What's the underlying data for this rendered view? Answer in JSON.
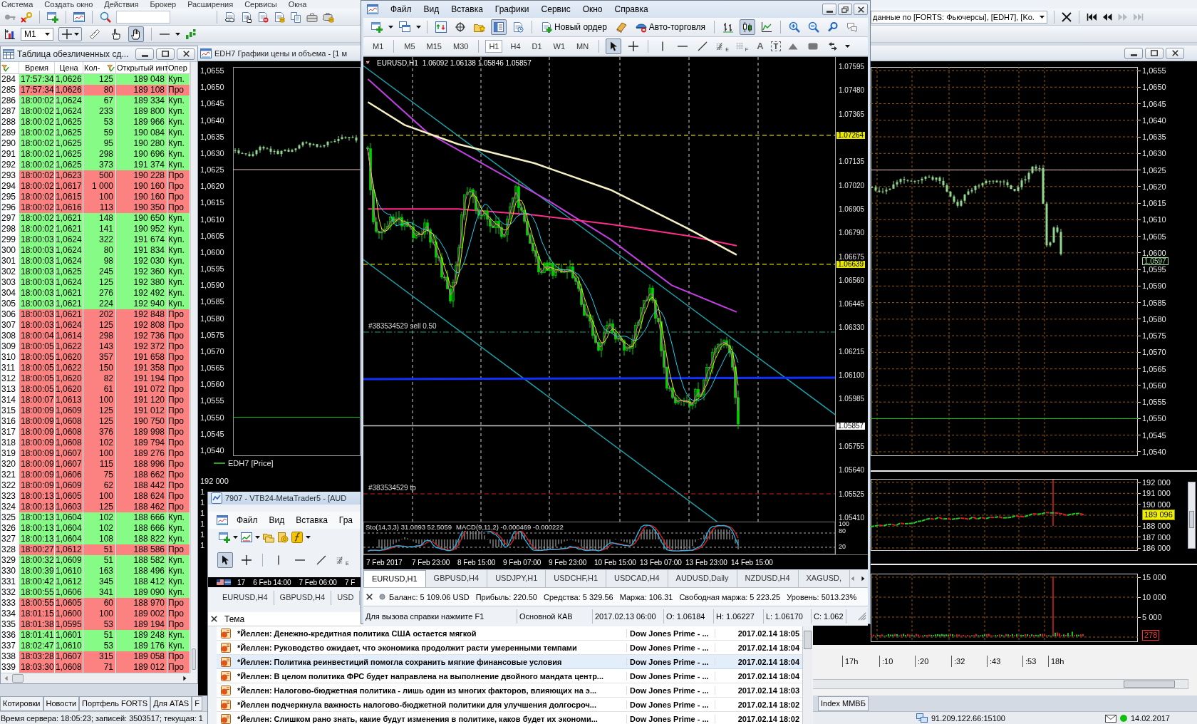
{
  "app_menu": [
    "Система",
    "Создать окно",
    "Действия",
    "Брокер",
    "Расширения",
    "Сервисы",
    "Окна"
  ],
  "app_toolbar": {
    "timeframe": "M1",
    "tools": [
      {
        "kind": "ruler",
        "selected": false
      },
      {
        "kind": "hand-point",
        "selected": false
      },
      {
        "kind": "hand",
        "selected": true
      }
    ],
    "data_source": "данные по [FORTS: Фьючерсы], [EDH7], [Ko.",
    "nav_buttons": [
      {
        "kind": "first",
        "disabled": false
      },
      {
        "kind": "back",
        "disabled": false
      },
      {
        "kind": "forward",
        "disabled": true
      },
      {
        "kind": "last",
        "disabled": true
      }
    ]
  },
  "trades": {
    "title": "Таблица обезличенных сд...",
    "columns": [
      "Время",
      "Цена",
      "Кол-",
      "Открытый инт",
      "Опер"
    ],
    "rows": [
      {
        "n": "284",
        "time": "17:57:34",
        "price": "1,0626",
        "qty": "125",
        "oi": "189 048",
        "op": "Куп.",
        "kind": "buy"
      },
      {
        "n": "285",
        "time": "17:57:34",
        "price": "1,0626",
        "qty": "80",
        "oi": "189 108",
        "op": "Про",
        "kind": "sell"
      },
      {
        "n": "286",
        "time": "18:00:02",
        "price": "1,0624",
        "qty": "67",
        "oi": "189 334",
        "op": "Куп.",
        "kind": "buy"
      },
      {
        "n": "287",
        "time": "18:00:02",
        "price": "1,0624",
        "qty": "233",
        "oi": "189 800",
        "op": "Куп.",
        "kind": "buy"
      },
      {
        "n": "288",
        "time": "18:00:02",
        "price": "1,0625",
        "qty": "53",
        "oi": "189 966",
        "op": "Куп.",
        "kind": "buy"
      },
      {
        "n": "289",
        "time": "18:00:02",
        "price": "1,0625",
        "qty": "59",
        "oi": "190 084",
        "op": "Куп.",
        "kind": "buy"
      },
      {
        "n": "290",
        "time": "18:00:02",
        "price": "1,0625",
        "qty": "95",
        "oi": "190 280",
        "op": "Куп.",
        "kind": "buy"
      },
      {
        "n": "291",
        "time": "18:00:02",
        "price": "1,0625",
        "qty": "298",
        "oi": "190 696",
        "op": "Куп.",
        "kind": "buy"
      },
      {
        "n": "292",
        "time": "18:00:02",
        "price": "1,0625",
        "qty": "373",
        "oi": "191 374",
        "op": "Куп.",
        "kind": "buy"
      },
      {
        "n": "293",
        "time": "18:00:02",
        "price": "1,0623",
        "qty": "500",
        "oi": "190 228",
        "op": "Про",
        "kind": "sell"
      },
      {
        "n": "294",
        "time": "18:00:02",
        "price": "1,0617",
        "qty": "1 000",
        "oi": "190 160",
        "op": "Про",
        "kind": "sell"
      },
      {
        "n": "295",
        "time": "18:00:02",
        "price": "1,0615",
        "qty": "100",
        "oi": "190 160",
        "op": "Про",
        "kind": "sell"
      },
      {
        "n": "296",
        "time": "18:00:02",
        "price": "1,0616",
        "qty": "113",
        "oi": "190 350",
        "op": "Про",
        "kind": "sell"
      },
      {
        "n": "297",
        "time": "18:00:02",
        "price": "1,0621",
        "qty": "148",
        "oi": "190 650",
        "op": "Куп.",
        "kind": "buy"
      },
      {
        "n": "298",
        "time": "18:00:02",
        "price": "1,0621",
        "qty": "141",
        "oi": "190 952",
        "op": "Куп.",
        "kind": "buy"
      },
      {
        "n": "299",
        "time": "18:00:03",
        "price": "1,0624",
        "qty": "322",
        "oi": "191 674",
        "op": "Куп.",
        "kind": "buy"
      },
      {
        "n": "300",
        "time": "18:00:03",
        "price": "1,0624",
        "qty": "80",
        "oi": "191 834",
        "op": "Куп.",
        "kind": "buy"
      },
      {
        "n": "301",
        "time": "18:00:03",
        "price": "1,0624",
        "qty": "98",
        "oi": "192 030",
        "op": "Куп.",
        "kind": "buy"
      },
      {
        "n": "302",
        "time": "18:00:03",
        "price": "1,0625",
        "qty": "245",
        "oi": "192 360",
        "op": "Куп.",
        "kind": "buy"
      },
      {
        "n": "303",
        "time": "18:00:03",
        "price": "1,0624",
        "qty": "125",
        "oi": "192 380",
        "op": "Куп.",
        "kind": "buy"
      },
      {
        "n": "304",
        "time": "18:00:03",
        "price": "1,0621",
        "qty": "276",
        "oi": "192 492",
        "op": "Куп.",
        "kind": "buy"
      },
      {
        "n": "305",
        "time": "18:00:03",
        "price": "1,0621",
        "qty": "224",
        "oi": "192 940",
        "op": "Куп.",
        "kind": "buy"
      },
      {
        "n": "306",
        "time": "18:00:03",
        "price": "1,0621",
        "qty": "202",
        "oi": "192 848",
        "op": "Про",
        "kind": "sell"
      },
      {
        "n": "307",
        "time": "18:00:03",
        "price": "1,0624",
        "qty": "125",
        "oi": "192 808",
        "op": "Про",
        "kind": "sell"
      },
      {
        "n": "308",
        "time": "18:00:04",
        "price": "1,0614",
        "qty": "298",
        "oi": "192 736",
        "op": "Про",
        "kind": "sell"
      },
      {
        "n": "309",
        "time": "18:00:05",
        "price": "1,0622",
        "qty": "143",
        "oi": "192 372",
        "op": "Про",
        "kind": "sell"
      },
      {
        "n": "310",
        "time": "18:00:05",
        "price": "1,0620",
        "qty": "357",
        "oi": "191 658",
        "op": "Про",
        "kind": "sell"
      },
      {
        "n": "311",
        "time": "18:00:05",
        "price": "1,0622",
        "qty": "150",
        "oi": "191 358",
        "op": "Про",
        "kind": "sell"
      },
      {
        "n": "312",
        "time": "18:00:05",
        "price": "1,0620",
        "qty": "82",
        "oi": "191 194",
        "op": "Про",
        "kind": "sell"
      },
      {
        "n": "313",
        "time": "18:00:05",
        "price": "1,0620",
        "qty": "61",
        "oi": "191 072",
        "op": "Про",
        "kind": "sell"
      },
      {
        "n": "314",
        "time": "18:00:07",
        "price": "1,0613",
        "qty": "100",
        "oi": "191 120",
        "op": "Про",
        "kind": "sell"
      },
      {
        "n": "315",
        "time": "18:00:09",
        "price": "1,0609",
        "qty": "125",
        "oi": "191 012",
        "op": "Про",
        "kind": "sell"
      },
      {
        "n": "316",
        "time": "18:00:09",
        "price": "1,0608",
        "qty": "125",
        "oi": "190 750",
        "op": "Про",
        "kind": "sell"
      },
      {
        "n": "317",
        "time": "18:00:09",
        "price": "1,0608",
        "qty": "376",
        "oi": "189 998",
        "op": "Про",
        "kind": "sell"
      },
      {
        "n": "318",
        "time": "18:00:09",
        "price": "1,0608",
        "qty": "102",
        "oi": "189 794",
        "op": "Про",
        "kind": "sell"
      },
      {
        "n": "319",
        "time": "18:00:09",
        "price": "1,0607",
        "qty": "100",
        "oi": "189 276",
        "op": "Про",
        "kind": "sell"
      },
      {
        "n": "320",
        "time": "18:00:09",
        "price": "1,0607",
        "qty": "115",
        "oi": "188 996",
        "op": "Про",
        "kind": "sell"
      },
      {
        "n": "321",
        "time": "18:00:09",
        "price": "1,0606",
        "qty": "75",
        "oi": "188 662",
        "op": "Про",
        "kind": "sell"
      },
      {
        "n": "322",
        "time": "18:00:09",
        "price": "1,0609",
        "qty": "62",
        "oi": "188 442",
        "op": "Про",
        "kind": "sell"
      },
      {
        "n": "323",
        "time": "18:00:13",
        "price": "1,0605",
        "qty": "100",
        "oi": "188 624",
        "op": "Про",
        "kind": "sell"
      },
      {
        "n": "324",
        "time": "18:00:13",
        "price": "1,0603",
        "qty": "125",
        "oi": "188 462",
        "op": "Про",
        "kind": "sell"
      },
      {
        "n": "325",
        "time": "18:00:13",
        "price": "1,0604",
        "qty": "102",
        "oi": "188 666",
        "op": "Куп.",
        "kind": "buy"
      },
      {
        "n": "326",
        "time": "18:00:13",
        "price": "1,0604",
        "qty": "102",
        "oi": "188 666",
        "op": "Куп.",
        "kind": "buy"
      },
      {
        "n": "327",
        "time": "18:00:13",
        "price": "1,0604",
        "qty": "108",
        "oi": "188 822",
        "op": "Куп.",
        "kind": "buy"
      },
      {
        "n": "328",
        "time": "18:00:27",
        "price": "1,0612",
        "qty": "51",
        "oi": "188 586",
        "op": "Про",
        "kind": "sell"
      },
      {
        "n": "329",
        "time": "18:00:32",
        "price": "1,0609",
        "qty": "51",
        "oi": "188 582",
        "op": "Куп.",
        "kind": "buy"
      },
      {
        "n": "330",
        "time": "18:00:39",
        "price": "1,0610",
        "qty": "163",
        "oi": "188 496",
        "op": "Куп.",
        "kind": "buy"
      },
      {
        "n": "331",
        "time": "18:00:42",
        "price": "1,0612",
        "qty": "345",
        "oi": "188 412",
        "op": "Куп.",
        "kind": "buy"
      },
      {
        "n": "332",
        "time": "18:00:55",
        "price": "1,0606",
        "qty": "341",
        "oi": "189 090",
        "op": "Куп.",
        "kind": "buy"
      },
      {
        "n": "333",
        "time": "18:00:55",
        "price": "1,0605",
        "qty": "60",
        "oi": "188 970",
        "op": "Про",
        "kind": "sell"
      },
      {
        "n": "334",
        "time": "18:01:15",
        "price": "1,0600",
        "qty": "100",
        "oi": "189 002",
        "op": "Про",
        "kind": "sell"
      },
      {
        "n": "335",
        "time": "18:01:38",
        "price": "1,0595",
        "qty": "53",
        "oi": "189 194",
        "op": "Про",
        "kind": "sell"
      },
      {
        "n": "336",
        "time": "18:01:41",
        "price": "1,0601",
        "qty": "51",
        "oi": "189 248",
        "op": "Куп.",
        "kind": "buy"
      },
      {
        "n": "337",
        "time": "18:02:47",
        "price": "1,0610",
        "qty": "53",
        "oi": "189 176",
        "op": "Куп.",
        "kind": "buy"
      },
      {
        "n": "338",
        "time": "18:03:28",
        "price": "1,0607",
        "qty": "315",
        "oi": "189 058",
        "op": "Про",
        "kind": "sell"
      },
      {
        "n": "339",
        "time": "18:03:30",
        "price": "1,0608",
        "qty": "71",
        "oi": "189 012",
        "op": "Про",
        "kind": "sell"
      }
    ]
  },
  "price_chart": {
    "title": "EDH7 Графики цены и объема - [1 м",
    "left_axis": [
      "1,0655",
      "1,0650",
      "1,0645",
      "1,0640",
      "1,0635",
      "1,0630",
      "1,0625",
      "1,0620",
      "1,0615",
      "1,0610",
      "1,0605",
      "1,0600",
      "1,0595",
      "1,0590",
      "1,0585",
      "1,0580",
      "1,0575",
      "1,0570",
      "1,0565",
      "1,0560",
      "1,0555",
      "1,0550",
      "1,0545",
      "1,0540"
    ],
    "legend": "EDH7 [Price]",
    "oi_left_axis": [
      "192 000",
      "1",
      "1",
      "1",
      "1",
      "1",
      "1"
    ],
    "right_axis": [
      "1,0655",
      "1,0650",
      "1,0645",
      "1,0640",
      "1,0635",
      "1,0630",
      "1,0625",
      "1,0620",
      "1,0615",
      "1,0610",
      "1,0605",
      "1,0600",
      "1,0595",
      "1,0590",
      "1,0585",
      "1,0580",
      "1,0575",
      "1,0570",
      "1,0565",
      "1,0560",
      "1,0555",
      "1,0550",
      "1,0545",
      "1,0540"
    ],
    "price_marker": "1,0597",
    "oi_axis": [
      "192 000",
      "191 000",
      "190 000",
      "188 000",
      "187 000",
      "186 000"
    ],
    "oi_marker": "189 096",
    "volume_axis": [
      "15 000",
      "10 000",
      "5 000"
    ],
    "volume_marker": "278",
    "time_axis": [
      "17h",
      ":10",
      ":20",
      ":32",
      ":43",
      ":53",
      "18h"
    ]
  },
  "bottom_tabs": [
    "Котировки",
    "Новости",
    "Портфель FORTS",
    "Для ATAS",
    "F"
  ],
  "bottom_tabs_right": [
    "Index ММВБ"
  ],
  "status_bar": {
    "server_info": "Время сервера: 18:05:23; записей: 3503517; текущая: 1",
    "address": "91.209.122.66:15100",
    "connected": true,
    "date": "14.02.2017"
  },
  "terminal2": {
    "title": "7907 - VTB24-MetaTrader5 - [AUD",
    "menu": [
      "Файл",
      "Вид",
      "Вставка",
      "Гра"
    ],
    "tools": [
      {
        "kind": "cursor",
        "selected": true
      },
      {
        "kind": "crosshair",
        "selected": false
      },
      {
        "kind": "separator"
      },
      {
        "kind": "vline",
        "selected": false
      },
      {
        "kind": "hline",
        "selected": false
      },
      {
        "kind": "trendline",
        "selected": false
      },
      {
        "kind": "fibo",
        "glyph": "E",
        "selected": false
      }
    ],
    "time_axis": [
      "17",
      "6 Feb 14:00",
      "7 Feb 06:00",
      "7 F"
    ],
    "tabs": [
      "EURUSD,H4",
      "GBPUSD,H4",
      "USD"
    ],
    "news": {
      "column": "Тема",
      "rows": [
        {
          "subject": "*Йеллен: Денежно-кредитная политика США остается мягкой",
          "source": "Dow Jones Prime - ...",
          "time": "2017.02.14 18:05",
          "selected": false
        },
        {
          "subject": "*Йеллен: Руководство ожидает, что экономика продолжит расти умеренными темпами",
          "source": "Dow Jones Prime - ...",
          "time": "2017.02.14 18:04",
          "selected": false
        },
        {
          "subject": "*Йеллен: Политика реинвестиций помогла сохранить мягкие финансовые условия",
          "source": "Dow Jones Prime - ...",
          "time": "2017.02.14 18:04",
          "selected": true
        },
        {
          "subject": "*Йеллен: В целом политика ФРС будет направлена на выполнение двойного мандата центр...",
          "source": "Dow Jones Prime - ...",
          "time": "2017.02.14 18:04",
          "selected": false
        },
        {
          "subject": "*Йеллен: Налогово-бюджетная политика - лишь один из многих факторов, влияющих на э...",
          "source": "Dow Jones Prime - ...",
          "time": "2017.02.14 18:03",
          "selected": false
        },
        {
          "subject": "*Йеллен подчеркнула важность налогово-бюджетной политики для улучшения долгосроч...",
          "source": "Dow Jones Prime - ...",
          "time": "2017.02.14 18:02",
          "selected": false
        },
        {
          "subject": "*Йеллен: Слишком рано знать, какие будут изменения в политике, каков будет их экономи...",
          "source": "Dow Jones Prime - ...",
          "time": "2017.02.14 18:02",
          "selected": false
        }
      ]
    }
  },
  "terminal": {
    "menu": [
      "Файл",
      "Вид",
      "Вставка",
      "Графики",
      "Сервис",
      "Окно",
      "Справка"
    ],
    "toolbar": [
      {
        "kind": "window-plus",
        "dropdown": true,
        "selected": false
      },
      {
        "kind": "windows-stack",
        "dropdown": true,
        "selected": false
      },
      {
        "kind": "separator"
      },
      {
        "kind": "window-arrows",
        "selected": false
      },
      {
        "kind": "target",
        "selected": false
      },
      {
        "kind": "folder-star",
        "selected": false
      },
      {
        "kind": "window-list",
        "selected": true
      },
      {
        "kind": "document-clock",
        "selected": false
      },
      {
        "kind": "separator"
      },
      {
        "kind": "document-plus",
        "label": "Новый ордер",
        "selected": false
      },
      {
        "kind": "book",
        "selected": false
      },
      {
        "kind": "cap-stop",
        "label": "Авто-торговля",
        "selected": false
      },
      {
        "kind": "separator"
      },
      {
        "kind": "bars",
        "selected": false
      },
      {
        "kind": "candles",
        "selected": true
      },
      {
        "kind": "line-chart",
        "selected": false
      },
      {
        "kind": "separator"
      },
      {
        "kind": "zoom-in",
        "selected": false
      },
      {
        "kind": "zoom-out",
        "selected": false
      },
      {
        "kind": "magnifier",
        "selected": false
      },
      {
        "kind": "chat",
        "selected": false
      }
    ],
    "timeframe_groups": [
      [
        {
          "label": "M1",
          "selected": false
        }
      ],
      [
        {
          "label": "M5",
          "selected": false
        },
        {
          "label": "M15",
          "selected": false
        },
        {
          "label": "M30",
          "selected": false
        }
      ],
      [
        {
          "label": "H1",
          "selected": true
        },
        {
          "label": "H4",
          "selected": false
        },
        {
          "label": "D1",
          "selected": false
        },
        {
          "label": "W1",
          "selected": false
        },
        {
          "label": "MN",
          "selected": false
        }
      ]
    ],
    "tools": [
      {
        "kind": "cursor",
        "selected": true
      },
      {
        "kind": "crosshair",
        "selected": false
      },
      {
        "kind": "separator"
      },
      {
        "kind": "vline",
        "selected": false
      },
      {
        "kind": "hline",
        "selected": false
      },
      {
        "kind": "trendline",
        "selected": false
      },
      {
        "kind": "fibo",
        "glyph": "E",
        "selected": false
      },
      {
        "kind": "fibo-grid",
        "glyph": "F",
        "selected": false
      },
      {
        "kind": "text",
        "glyph": "A",
        "selected": false
      },
      {
        "kind": "label",
        "glyph": "T",
        "selected": false
      },
      {
        "kind": "triangle",
        "selected": false
      },
      {
        "kind": "rectangle",
        "selected": false
      },
      {
        "kind": "arrows",
        "dropdown": true,
        "selected": false
      }
    ],
    "chart": {
      "symbol": "EURUSD,H1",
      "ohlc": "1.06092 1.06138 1.05846 1.05857",
      "price_ticks": [
        "1.07595",
        "1.07480",
        "1.07365",
        "1.07135",
        "1.07020",
        "1.06905",
        "1.06790",
        "1.06675",
        "1.06560",
        "1.06445",
        "1.06330",
        "1.06215",
        "1.06100",
        "1.05985",
        "1.05755",
        "1.05640",
        "1.05525",
        "1.05410"
      ],
      "price_markers": [
        {
          "label": "1.07264",
          "kind": "line"
        },
        {
          "label": "1.06639",
          "kind": "line"
        },
        {
          "label": "1.05857",
          "kind": "bid"
        }
      ],
      "order_labels": [
        {
          "label": "#383534529 sell 0.50",
          "kind": "sell"
        },
        {
          "label": "#383534529 tp",
          "kind": "tp"
        }
      ]
    },
    "indicator": {
      "labels": [
        "Sto(14,3,3) 31.0893 52.5059",
        "MACD(9,11,2) -0.000469 -0.000222"
      ],
      "axis": [
        "100",
        "80",
        "20"
      ]
    },
    "time_axis": [
      "7 Feb 2017",
      "7 Feb 23:00",
      "8 Feb 15:00",
      "9 Feb 07:00",
      "9 Feb 23:00",
      "10 Feb 15:00",
      "13 Feb 07:00",
      "13 Feb 23:00",
      "14 Feb 15:00"
    ],
    "tabs": [
      {
        "label": "EURUSD,H1",
        "selected": true
      },
      {
        "label": "GBPUSD,H4",
        "selected": false
      },
      {
        "label": "USDJPY,H1",
        "selected": false
      },
      {
        "label": "USDCHF,H1",
        "selected": false
      },
      {
        "label": "USDCAD,H4",
        "selected": false
      },
      {
        "label": "AUDUSD,Daily",
        "selected": false
      },
      {
        "label": "NZDUSD,H4",
        "selected": false
      },
      {
        "label": "XAGUSD,",
        "selected": false
      }
    ],
    "account": [
      "Баланс: 5 109.06 USD",
      "Прибыль: 220.50",
      "Средства: 5 329.56",
      "Маржа: 106.31",
      "Свободная маржа: 5 223.25",
      "Уровень: 5013.23%"
    ],
    "status": [
      "Для вызова справки нажмите F1",
      "Основной КАВ",
      "2017.02.13 06:00",
      "O: 1.06184",
      "H: 1.06227",
      "L: 1.06170",
      "C: 1.062"
    ]
  }
}
